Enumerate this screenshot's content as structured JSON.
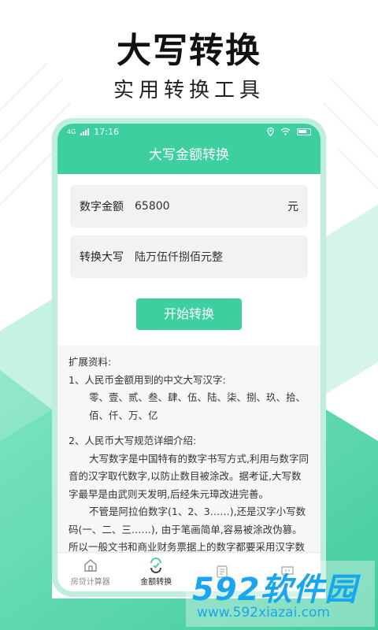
{
  "hero": {
    "title": "大写转换",
    "subtitle": "实用转换工具"
  },
  "status_bar": {
    "network": "4G",
    "time": "17:16"
  },
  "app": {
    "title": "大写金额转换"
  },
  "form": {
    "amount_label": "数字金额",
    "amount_value": "65800",
    "amount_unit": "元",
    "result_label": "转换大写",
    "result_value": "陆万伍仟捌佰元整",
    "convert_button": "开始转换"
  },
  "info": {
    "heading": "扩展资料:",
    "item1_title": "1、人民币金额用到的中文大写汉字:",
    "item1_body": "零、壹、贰、叁、肆、伍、陆、柒、捌、玖、拾、佰、仟、万、亿",
    "item2_title": "2、人民币大写规范详细介绍:",
    "item2_para1": "大写数字是中国特有的数字书写方式,利用与数字同音的汉字取代数字,以防止数目被涂改。据考证,大写数字最早是由武则天发明,后经朱元璋改进完善。",
    "item2_para2": "不管是阿拉伯数字(1、2、3……),还是汉字小写数码(一、二、三……), 由于笔画简单,容易被涂改伪篡。所以一般文书和商业财务票据上的数字都要采用汉字数码大写:零、壹、贰、叁、肆、伍、陆、柒、捌、玖、"
  },
  "tabs": [
    {
      "label": "房贷计算器",
      "icon": "house-icon"
    },
    {
      "label": "金额转换",
      "icon": "convert-icon"
    },
    {
      "label": "",
      "icon": "document-icon"
    },
    {
      "label": "",
      "icon": "chat-icon"
    }
  ],
  "watermark": {
    "brand": "592软件园",
    "url": "www.592xiazai.com"
  },
  "colors": {
    "accent": "#3ecfa0",
    "phone_frame": "#bfeedd",
    "watermark": "#1aa6ee"
  }
}
